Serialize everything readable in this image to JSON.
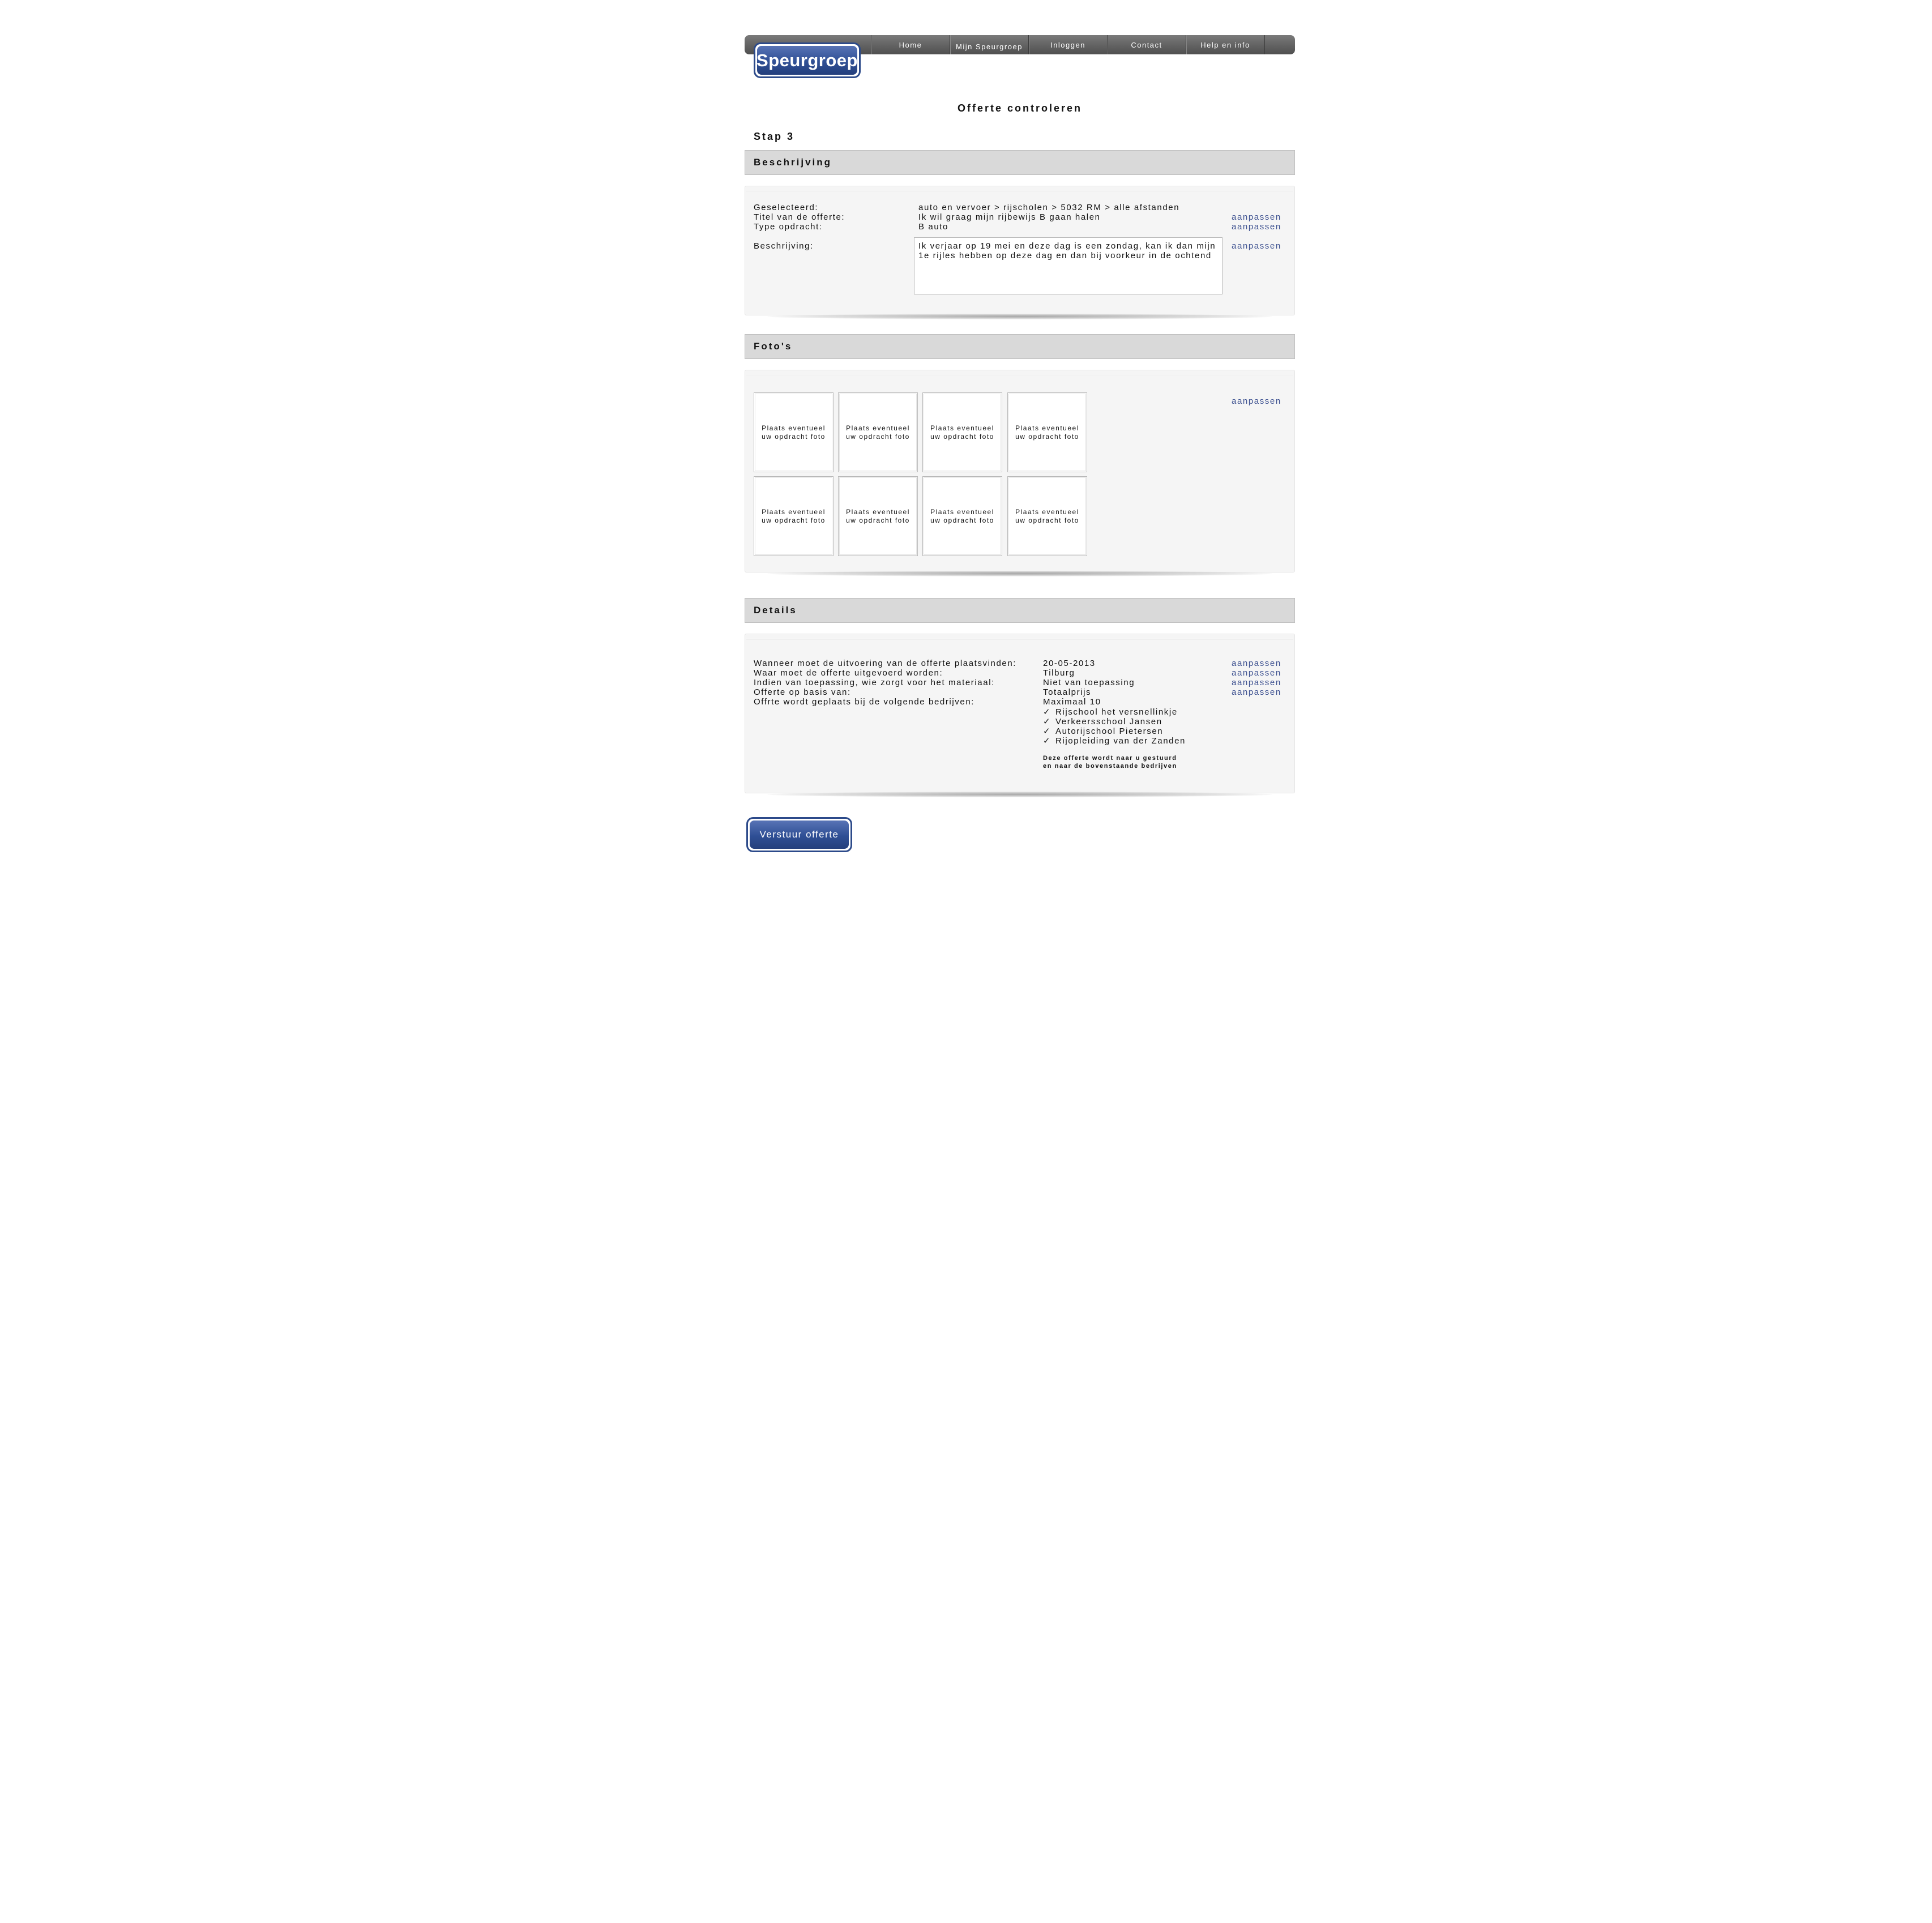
{
  "header": {
    "logo": "Speurgroep",
    "nav": [
      "Home",
      "Mijn Speurgroep",
      "Inloggen",
      "Contact",
      "Help en info"
    ]
  },
  "page": {
    "title": "Offerte controleren",
    "step": "Stap 3"
  },
  "beschrijving": {
    "heading": "Beschrijving",
    "rows": [
      {
        "label": "Geselecteerd:",
        "value": "auto en vervoer > rijscholen > 5032 RM > alle afstanden"
      },
      {
        "label": "Titel van de offerte:",
        "value": "Ik wil graag mijn rijbewijs B gaan halen"
      },
      {
        "label": "Type opdracht:",
        "value": "B auto"
      }
    ],
    "description_label": "Beschrijving:",
    "description_lines": [
      "Ik verjaar op 19 mei en deze dag is een zondag, kan ik dan mijn",
      "1e rijles hebben op deze dag en dan bij voorkeur in de ochtend"
    ],
    "edit_link": "aanpassen"
  },
  "fotos": {
    "heading": "Foto's",
    "placeholder_line1": "Plaats eventueel",
    "placeholder_line2": "uw opdracht foto",
    "edit_link": "aanpassen"
  },
  "details": {
    "heading": "Details",
    "rows": [
      {
        "label": "Wanneer moet de uitvoering van de offerte plaatsvinden:",
        "value": "20-05-2013"
      },
      {
        "label": "Waar moet de offerte uitgevoerd worden:",
        "value": "Tilburg"
      },
      {
        "label": "Indien van toepassing, wie zorgt voor het materiaal:",
        "value": "Niet van toepassing"
      },
      {
        "label": "Offerte op basis van:",
        "value": "Totaalprijs"
      },
      {
        "label": "Offrte wordt geplaats bij de volgende bedrijven:",
        "value": "Maximaal 10"
      }
    ],
    "companies": [
      "Rijschool het versnellinkje",
      "Verkeersschool Jansen",
      "Autorijschool Pietersen",
      "Rijopleiding van der Zanden"
    ],
    "note_line1": "Deze offerte wordt naar u gestuurd",
    "note_line2": "en naar de bovenstaande bedrijven",
    "edit_link": "aanpassen"
  },
  "actions": {
    "send_label": "Verstuur offerte"
  },
  "colors": {
    "brand_blue": "#2f4f95",
    "link_blue": "#3b4f8f",
    "nav_gray": "#5a5a5a"
  }
}
